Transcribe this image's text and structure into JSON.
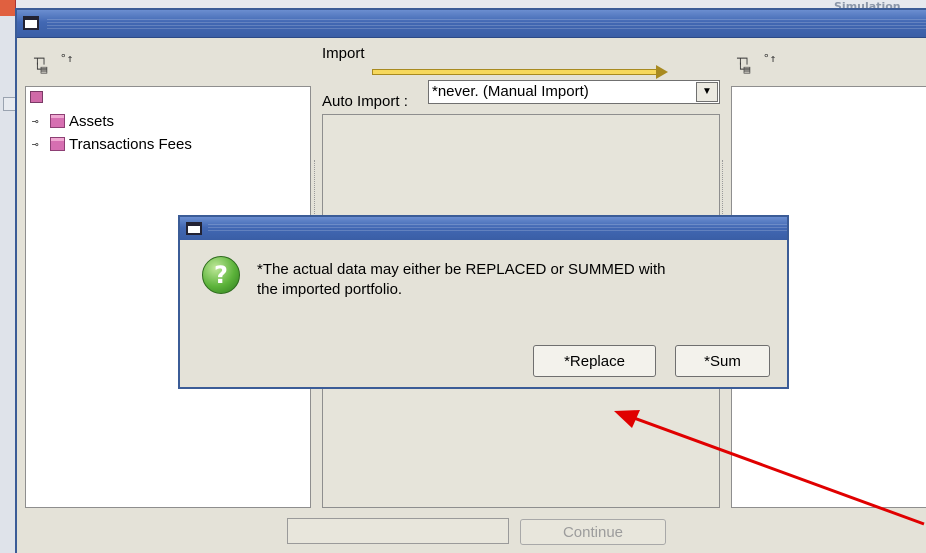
{
  "background": {
    "window_title_fragment": "Simulation"
  },
  "window": {
    "toolbar_left_icons": [
      "tree-expand-icon",
      "tree-up-icon"
    ],
    "toolbar_right_icons": [
      "tree-expand-icon",
      "tree-up-icon"
    ],
    "import_label": "Import",
    "auto_import_label": "Auto Import :",
    "auto_import_value": "*never. (Manual Import)",
    "tree_items": [
      {
        "label": "Assets"
      },
      {
        "label": "Transactions Fees"
      }
    ],
    "continue_label": "Continue",
    "status_text": ""
  },
  "dialog": {
    "message": "*The actual data may either be REPLACED or SUMMED with\nthe imported portfolio.",
    "replace_label": "*Replace",
    "sum_label": "*Sum",
    "icon": "question-icon"
  },
  "colors": {
    "titlebar": "#4268b3",
    "arrow_import": "#f6d85c",
    "annotation_arrow": "#e00000",
    "question_icon": "#5cb33a"
  }
}
